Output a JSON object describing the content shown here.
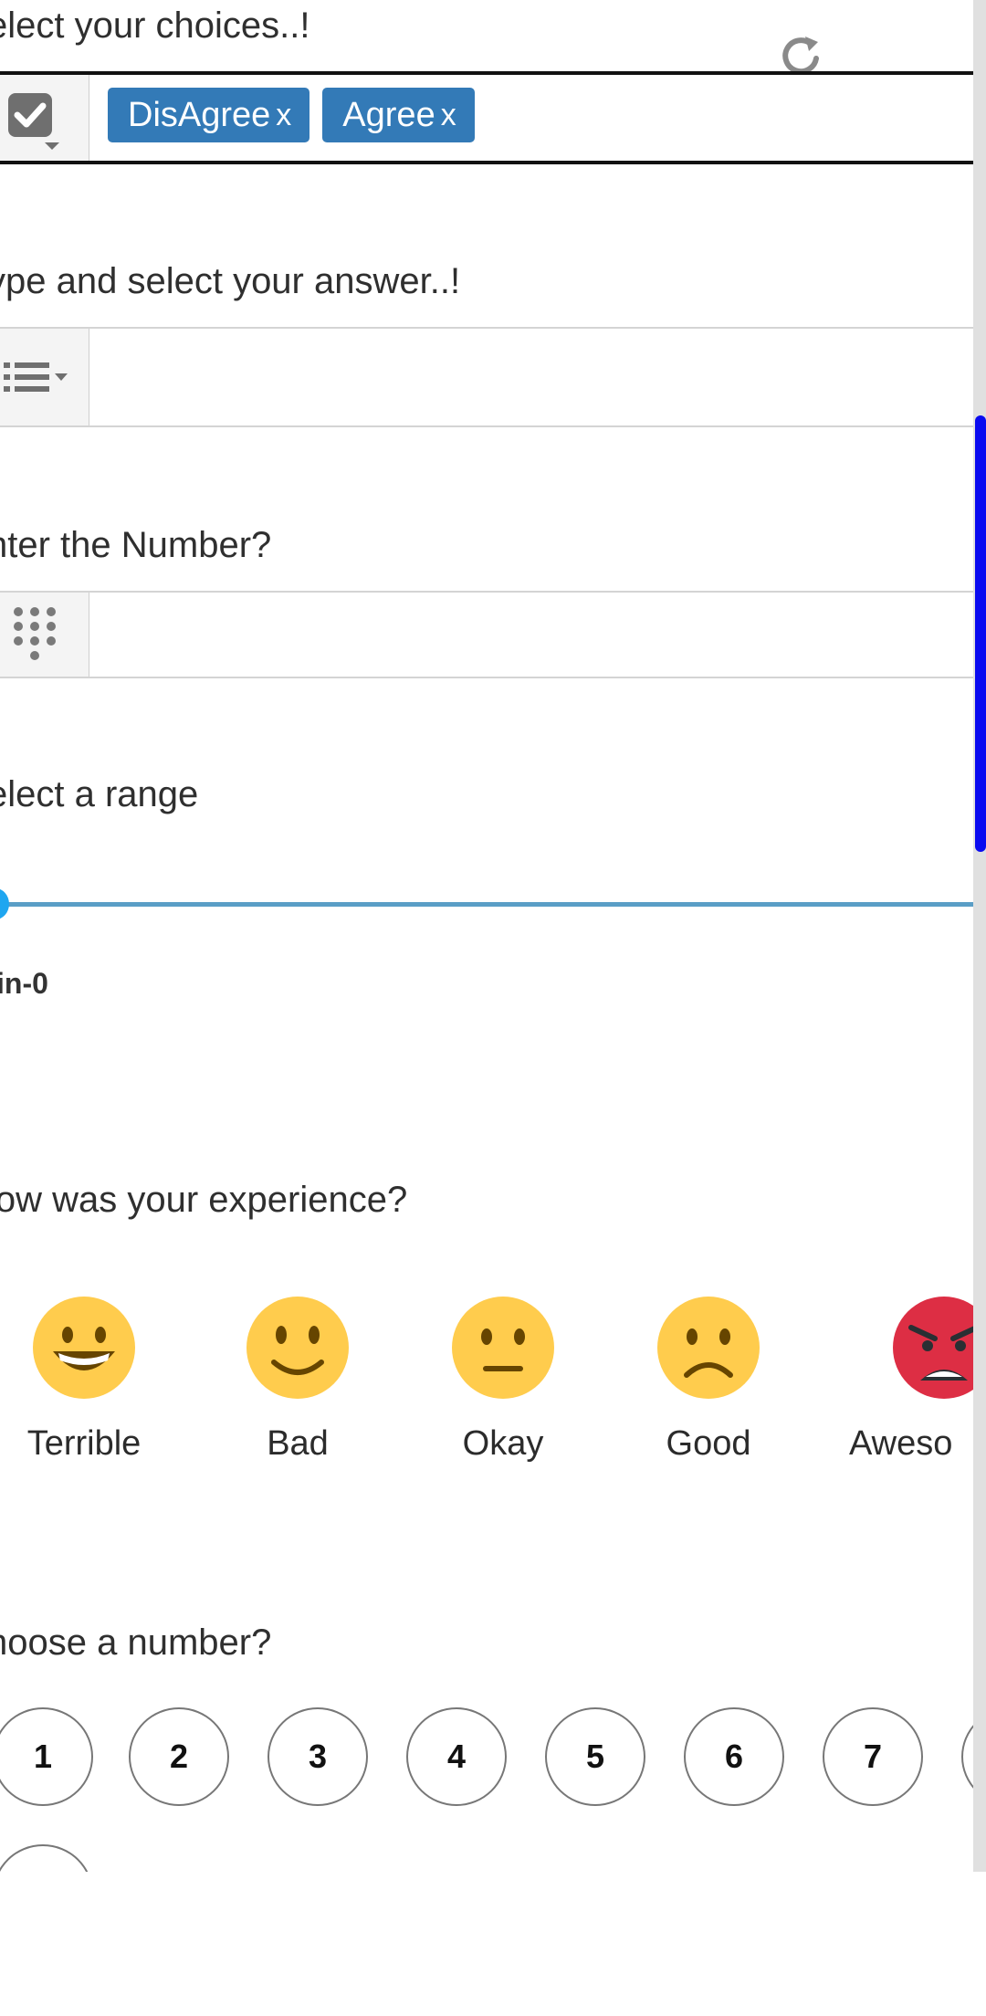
{
  "questions": {
    "choices": "elect your choices..!",
    "answer": "ype and select your answer..!",
    "number": "nter the Number?",
    "range": "elect a range",
    "experience": "low was your experience?",
    "choose_number": "hoose a number?"
  },
  "choices_field": {
    "tags": [
      {
        "label": "DisAgree",
        "remove": "x"
      },
      {
        "label": "Agree",
        "remove": "x"
      }
    ]
  },
  "answer_field": {
    "value": ""
  },
  "number_field": {
    "value": ""
  },
  "range": {
    "min_label": "in-0",
    "value_fraction": 0.0
  },
  "rating": {
    "items": [
      {
        "label": "Terrible",
        "emoji": "grinning-face-icon"
      },
      {
        "label": "Bad",
        "emoji": "slightly-smiling-face-icon"
      },
      {
        "label": "Okay",
        "emoji": "neutral-face-icon"
      },
      {
        "label": "Good",
        "emoji": "frowning-face-icon"
      },
      {
        "label": "Aweso",
        "emoji": "angry-face-icon"
      }
    ]
  },
  "numbers": [
    "1",
    "2",
    "3",
    "4",
    "5",
    "6",
    "7"
  ],
  "colors": {
    "tag_bg": "#337ab7",
    "slider_thumb": "#1fa6f0",
    "slider_track": "#5a9ec6",
    "scrollbar_thumb": "#0a0af0",
    "emoji_yellow": "#ffcc4d",
    "emoji_red": "#dd2e44"
  }
}
